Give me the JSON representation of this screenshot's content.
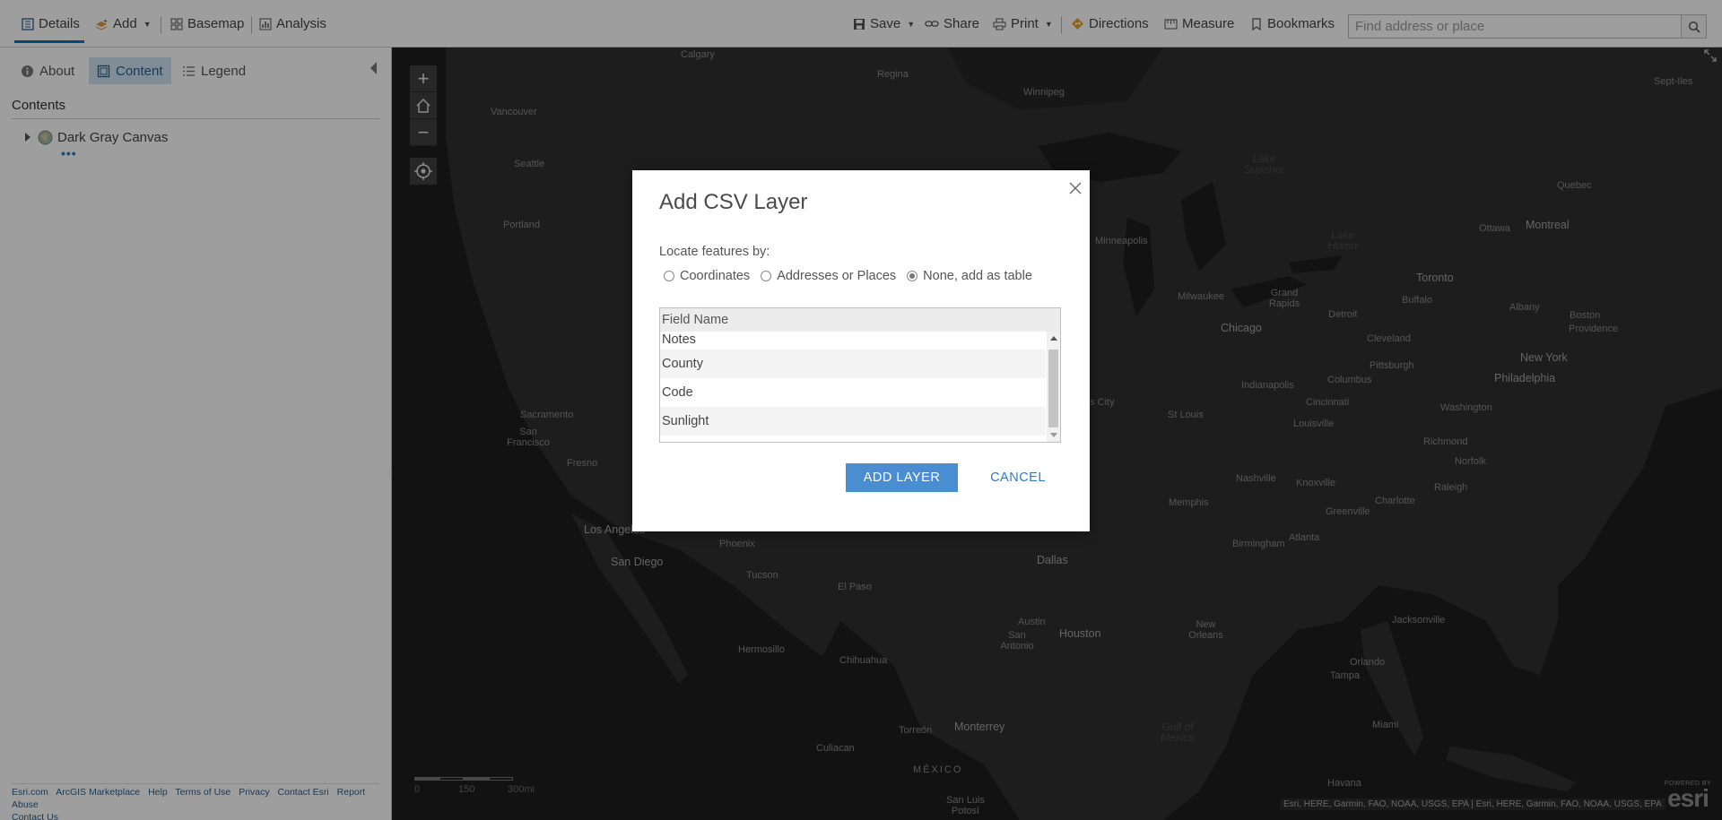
{
  "toolbar": {
    "details": "Details",
    "add": "Add",
    "basemap": "Basemap",
    "analysis": "Analysis",
    "save": "Save",
    "share": "Share",
    "print": "Print",
    "directions": "Directions",
    "measure": "Measure",
    "bookmarks": "Bookmarks",
    "search_placeholder": "Find address or place"
  },
  "panel": {
    "tabs": {
      "about": "About",
      "content": "Content",
      "legend": "Legend"
    },
    "contents_title": "Contents",
    "layer": "Dark Gray Canvas",
    "layer_more": "•••",
    "footer_links": [
      "Esri.com",
      "ArcGIS Marketplace",
      "Help",
      "Terms of Use",
      "Privacy",
      "Contact Esri",
      "Report Abuse",
      "Contact Us"
    ]
  },
  "map": {
    "cities": [
      "Calgary",
      "Regina",
      "Winnipeg",
      "Vancouver",
      "Seattle",
      "Portland",
      "Sacramento",
      "San Francisco",
      "Fresno",
      "Los Angeles",
      "San Diego",
      "Phoenix",
      "Tucson",
      "El Paso",
      "Hermosillo",
      "Chihuahua",
      "Culiacan",
      "Torreón",
      "Monterrey",
      "MÉXICO",
      "San Luis Potosí",
      "Dallas",
      "Austin",
      "San Antonio",
      "Houston",
      "Minneapolis",
      "as City",
      "St Louis",
      "Memphis",
      "Nashville",
      "Knoxville",
      "Atlanta",
      "Birmingham",
      "Chicago",
      "Milwaukee",
      "Grand Rapids",
      "Detroit",
      "Indianapolis",
      "Columbus",
      "Cincinnati",
      "Louisville",
      "Cleveland",
      "Pittsburgh",
      "Buffalo",
      "Toronto",
      "Ottawa",
      "Montreal",
      "Quebec",
      "Albany",
      "Boston",
      "Providence",
      "New York",
      "Philadelphia",
      "Washington",
      "Richmond",
      "Norfolk",
      "Raleigh",
      "Charlotte",
      "Greenville",
      "Jacksonville",
      "Orlando",
      "Tampa",
      "Miami",
      "Havana",
      "New Orleans",
      "Sept-Iles"
    ],
    "water": [
      "Lake Superior",
      "Lake Huron",
      "Gulf of Mexico"
    ],
    "scale": {
      "zero": "0",
      "mid": "150",
      "end": "300mi"
    },
    "attribution": "Esri, HERE, Garmin, FAO, NOAA, USGS, EPA | Esri, HERE, Garmin, FAO, NOAA, USGS, EPA",
    "powered_by": "POWERED BY",
    "logo": "esri"
  },
  "dialog": {
    "title": "Add CSV Layer",
    "locate_label": "Locate features by:",
    "options": [
      "Coordinates",
      "Addresses or Places",
      "None, add as table"
    ],
    "selected_option": "None, add as table",
    "table_header": "Field Name",
    "fields": [
      "Notes",
      "County",
      "Code",
      "Sunlight"
    ],
    "add_button": "ADD LAYER",
    "cancel_button": "CANCEL"
  },
  "colors": {
    "accent": "#0079c1",
    "button_primary": "#4a8ed1",
    "map_background": "#1f1f1f",
    "active_tab_bg": "#cfe3f2"
  }
}
